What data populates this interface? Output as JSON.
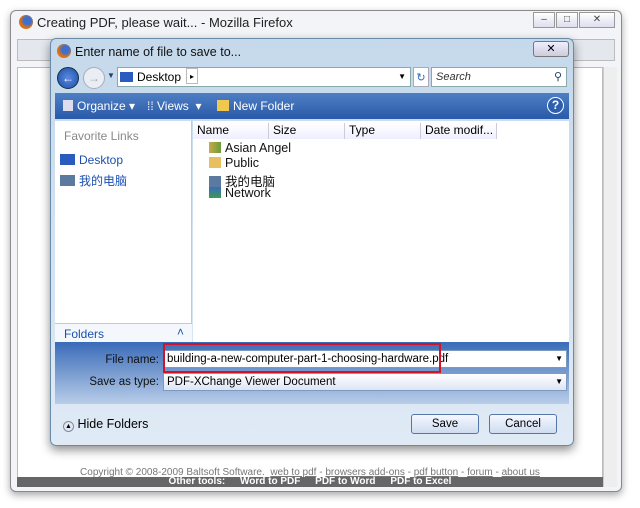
{
  "browser": {
    "title": "Creating PDF, please wait... - Mozilla Firefox"
  },
  "dialog": {
    "title": "Enter name of file to save to...",
    "address": "Desktop",
    "search_placeholder": "Search",
    "toolbar": {
      "organize": "Organize",
      "views": "Views",
      "new_folder": "New Folder"
    },
    "favorites_header": "Favorite Links",
    "favorites": [
      {
        "label": "Desktop",
        "icon": "desktop-icon"
      },
      {
        "label": "我的电脑",
        "icon": "computer-icon"
      }
    ],
    "folders_label": "Folders",
    "columns": [
      "Name",
      "Size",
      "Type",
      "Date modif..."
    ],
    "items": [
      {
        "label": "Asian Angel",
        "icon": "user-folder-icon"
      },
      {
        "label": "Public",
        "icon": "folder-icon"
      },
      {
        "label": "我的电脑",
        "icon": "computer-icon"
      },
      {
        "label": "Network",
        "icon": "network-icon"
      }
    ],
    "file_name_label": "File name:",
    "file_name": "building-a-new-computer-part-1-choosing-hardware.pdf",
    "save_type_label": "Save as type:",
    "save_type": "PDF-XChange Viewer Document",
    "hide_folders": "Hide Folders",
    "save": "Save",
    "cancel": "Cancel",
    "highlight_color": "#d0152a"
  },
  "footer": {
    "copyright": "Copyright © 2008-2009 Baltsoft Software.",
    "links": [
      "web to pdf",
      "browsers add-ons",
      "pdf button",
      "forum",
      "about us"
    ],
    "other_tools_label": "Other tools:",
    "tools": [
      "Word to PDF",
      "PDF to Word",
      "PDF to Excel"
    ]
  }
}
